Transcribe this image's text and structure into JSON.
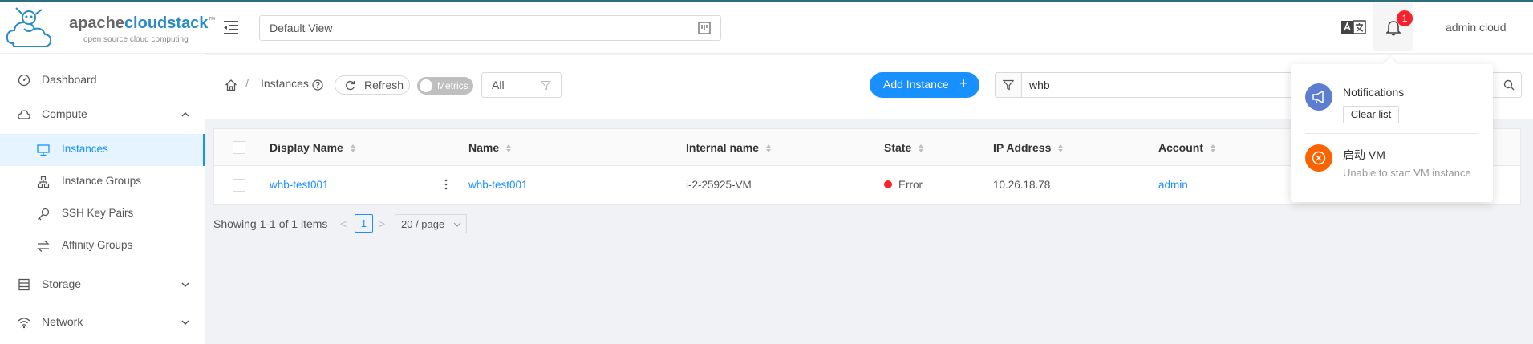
{
  "app": {
    "logo_prefix": "apache",
    "logo_brand": "cloudstack",
    "logo_tm": "™",
    "logo_tagline": "open source cloud computing"
  },
  "header": {
    "view_select": "Default View",
    "notification_count": "1",
    "user": "admin cloud"
  },
  "sidebar": {
    "items": [
      {
        "label": "Dashboard",
        "icon": "dashboard-icon"
      },
      {
        "label": "Compute",
        "icon": "cloud-icon",
        "expanded": true
      },
      {
        "label": "Instances",
        "icon": "desktop-icon",
        "active": true
      },
      {
        "label": "Instance Groups",
        "icon": "cluster-icon"
      },
      {
        "label": "SSH Key Pairs",
        "icon": "key-icon"
      },
      {
        "label": "Affinity Groups",
        "icon": "swap-icon"
      },
      {
        "label": "Storage",
        "icon": "database-icon"
      },
      {
        "label": "Network",
        "icon": "wifi-icon"
      }
    ]
  },
  "toolbar": {
    "breadcrumb_sep": "/",
    "breadcrumb_label": "Instances",
    "refresh_label": "Refresh",
    "metrics_label": "Metrics",
    "filter_value": "All",
    "add_label": "Add Instance",
    "add_plus": "+",
    "search_value": "whb"
  },
  "table": {
    "columns": [
      "Display Name",
      "Name",
      "Internal name",
      "State",
      "IP Address",
      "Account"
    ],
    "rows": [
      {
        "display_name": "whb-test001",
        "name": "whb-test001",
        "internal_name": "i-2-25925-VM",
        "state": "Error",
        "ip": "10.26.18.78",
        "account": "admin"
      }
    ]
  },
  "pagination": {
    "summary": "Showing 1-1 of 1 items",
    "prev": "<",
    "current": "1",
    "next": ">",
    "page_size": "20 / page"
  },
  "notifications": {
    "title": "Notifications",
    "clear_label": "Clear list",
    "items": [
      {
        "title": "启动 VM",
        "description": "Unable to start VM instance"
      }
    ]
  },
  "colors": {
    "primary": "#1890ff",
    "error": "#f5222d",
    "notif_avatar": "#5c7dd0",
    "error_avatar": "#fa6400"
  }
}
